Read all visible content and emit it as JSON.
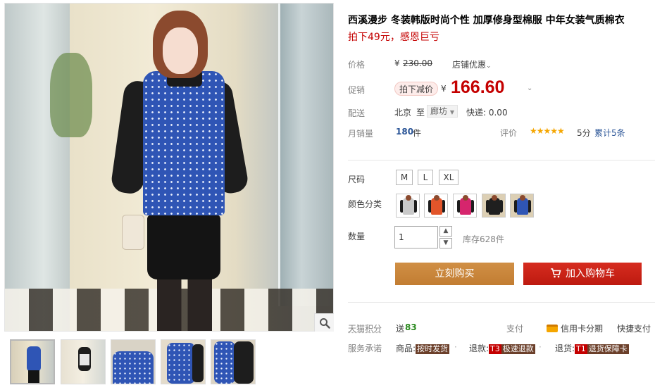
{
  "product": {
    "title": "西溪漫步 冬装韩版时尚个性 加厚修身型棉服 中年女装气质棉衣",
    "subtitle": "拍下49元，感恩巨亏"
  },
  "price": {
    "label": "价格",
    "currency": "¥",
    "original": "230.00",
    "shop_discount": "店铺优惠",
    "promo_label": "促销",
    "promo_tag": "拍下减价",
    "promo_price": "166.60"
  },
  "delivery": {
    "label": "配送",
    "from": "北京",
    "to_word": "至",
    "to": "廊坊",
    "express": "快递: 0.00"
  },
  "sales": {
    "label": "月销量",
    "count": "180",
    "unit": "件",
    "rating_label": "评价",
    "stars": "★★★★★",
    "score": "5分",
    "total": "累计5条"
  },
  "sku": {
    "size_label": "尺码",
    "sizes": [
      "M",
      "L",
      "XL"
    ],
    "color_label": "颜色分类",
    "qty_label": "数量",
    "qty_value": "1",
    "stock": "库存628件"
  },
  "actions": {
    "buy_now": "立刻购买",
    "add_to_cart": "加入购物车"
  },
  "services": {
    "points_label": "天猫积分",
    "points_prefix": "送",
    "points_value": "83",
    "pay_label": "支付",
    "credit": "信用卡分期",
    "quick_pay": "快捷支付",
    "promise_label": "服务承诺",
    "goods_prefix": "商品:",
    "goods_tag": "按时发货",
    "refund_prefix": "退款:",
    "refund_code": "T3",
    "refund_tag": "极速退款",
    "return_prefix": "退货:",
    "return_code": "T1",
    "return_tag": "退货保障卡",
    "dot": "·"
  },
  "colors": {
    "price_red": "#c40000",
    "buy_orange": "#c9893e",
    "cart_red": "#c8221a",
    "points_green": "#2b8a1f",
    "sales_blue": "#2b5597"
  }
}
